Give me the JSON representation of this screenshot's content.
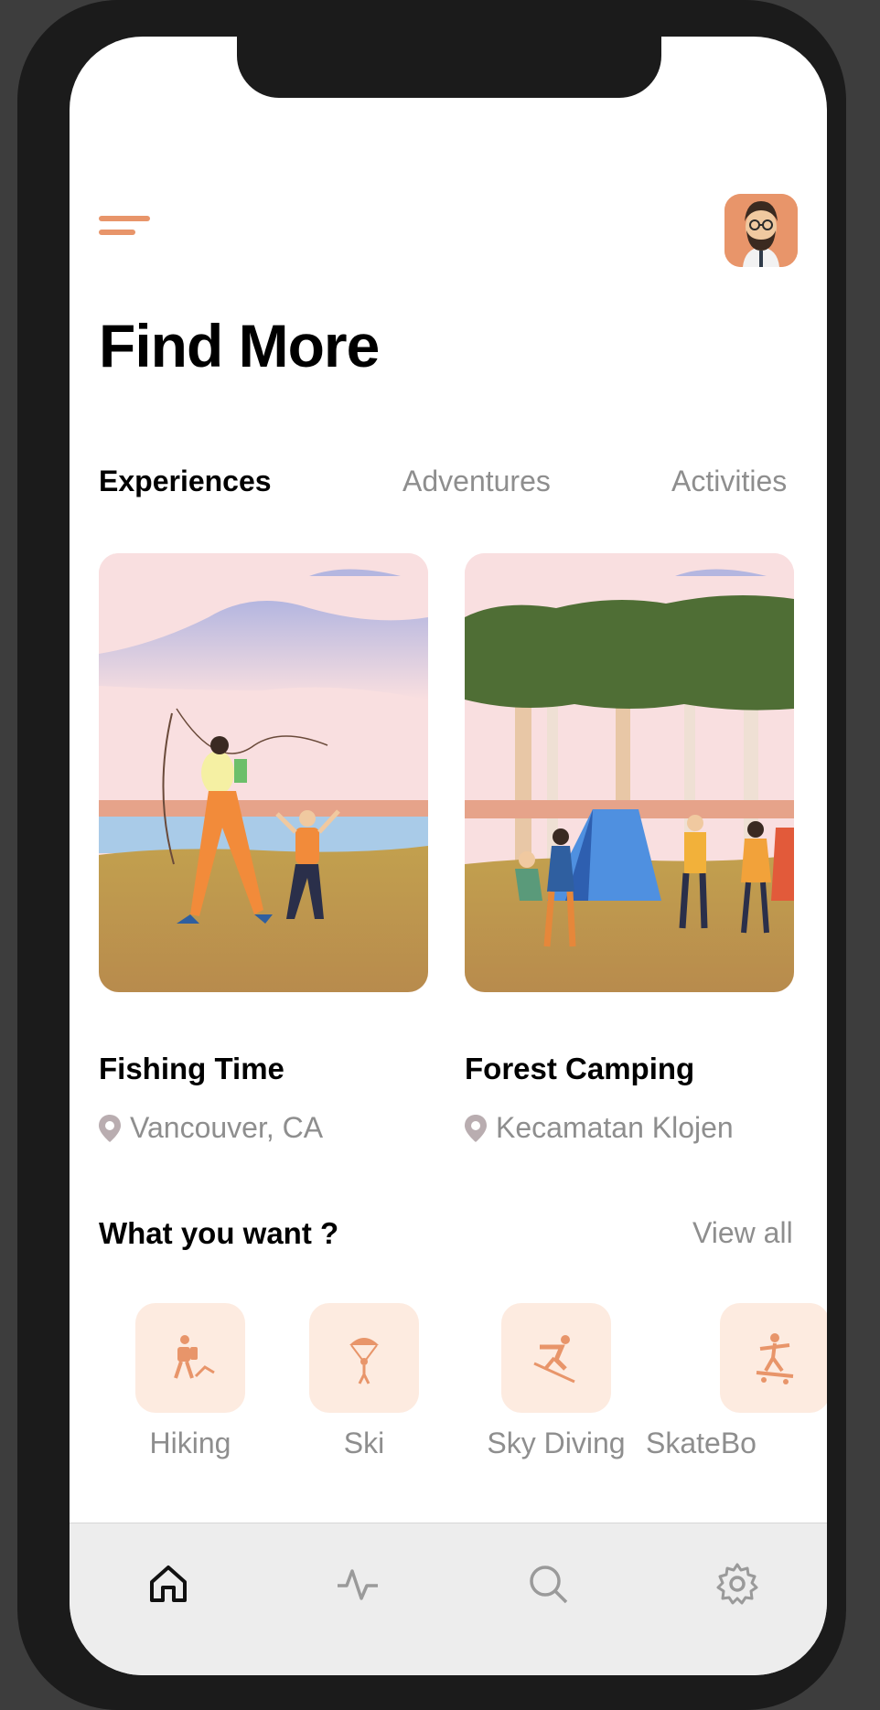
{
  "header": {
    "menu_icon": "menu-icon",
    "avatar": "user-avatar"
  },
  "page": {
    "title": "Find More"
  },
  "tabs": [
    {
      "label": "Experiences",
      "active": true
    },
    {
      "label": "Adventures",
      "active": false
    },
    {
      "label": "Activities",
      "active": false
    }
  ],
  "cards": [
    {
      "title": "Fishing Time",
      "location": "Vancouver, CA",
      "icon": "location-pin-icon"
    },
    {
      "title": "Forest Camping",
      "location": "Kecamatan Klojen",
      "icon": "location-pin-icon"
    }
  ],
  "categories_section": {
    "title": "What you want ?",
    "view_all": "View all"
  },
  "categories": [
    {
      "label": "Hiking",
      "icon": "hiking-icon"
    },
    {
      "label": "Ski",
      "icon": "parachute-icon"
    },
    {
      "label": "Sky Diving",
      "icon": "skiing-icon"
    },
    {
      "label": "SkateBo",
      "icon": "skateboard-icon"
    }
  ],
  "tabbar": [
    {
      "name": "home-icon",
      "active": true
    },
    {
      "name": "activity-icon",
      "active": false
    },
    {
      "name": "search-icon",
      "active": false
    },
    {
      "name": "settings-icon",
      "active": false
    }
  ],
  "colors": {
    "accent": "#e8956a",
    "category_bg": "#fdebe0",
    "muted_text": "#8e8e8e"
  }
}
